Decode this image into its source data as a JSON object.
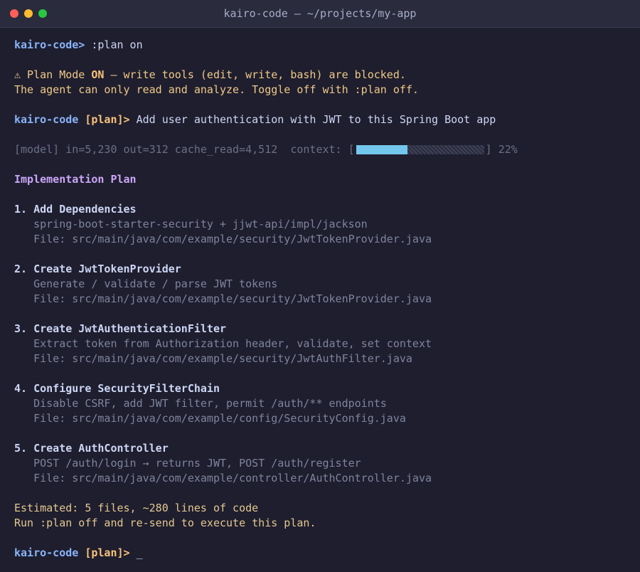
{
  "window": {
    "title": "kairo-code — ~/projects/my-app"
  },
  "lines": {
    "prompt1": "kairo-code>",
    "cmd1": " :plan on",
    "warn_icon": "⚠",
    "warn_a": " Plan Mode ",
    "warn_on": "ON",
    "warn_b": " — write tools (edit, write, bash) are blocked.",
    "warn2": "The agent can only read and analyze. Toggle off with :plan off.",
    "prompt2": "kairo-code",
    "mode2": "[plan]>",
    "cmd2": "Add user authentication with JWT to this Spring Boot app",
    "stats": "[model] in=5,230 out=312 cache_read=4,512  context: [",
    "context_pct_text": "] 22%",
    "plan_heading": "Implementation Plan"
  },
  "context_usage": 0.4,
  "steps": [
    {
      "title": "1. Add Dependencies",
      "desc": "   spring-boot-starter-security + jjwt-api/impl/jackson",
      "file": "   File: src/main/java/com/example/security/JwtTokenProvider.java"
    },
    {
      "title": "2. Create JwtTokenProvider",
      "desc": "   Generate / validate / parse JWT tokens",
      "file": "   File: src/main/java/com/example/security/JwtTokenProvider.java"
    },
    {
      "title": "3. Create JwtAuthenticationFilter",
      "desc": "   Extract token from Authorization header, validate, set context",
      "file": "   File: src/main/java/com/example/security/JwtAuthFilter.java"
    },
    {
      "title": "4. Configure SecurityFilterChain",
      "desc": "   Disable CSRF, add JWT filter, permit /auth/** endpoints",
      "file": "   File: src/main/java/com/example/config/SecurityConfig.java"
    },
    {
      "title": "5. Create AuthController",
      "desc": "   POST /auth/login → returns JWT, POST /auth/register",
      "file": "   File: src/main/java/com/example/controller/AuthController.java"
    }
  ],
  "footer": {
    "estimate": "Estimated: 5 files, ~280 lines of code",
    "instruction": "Run :plan off and re-send to execute this plan.",
    "prompt": "kairo-code",
    "mode": "[plan]>",
    "cursor": "_"
  }
}
